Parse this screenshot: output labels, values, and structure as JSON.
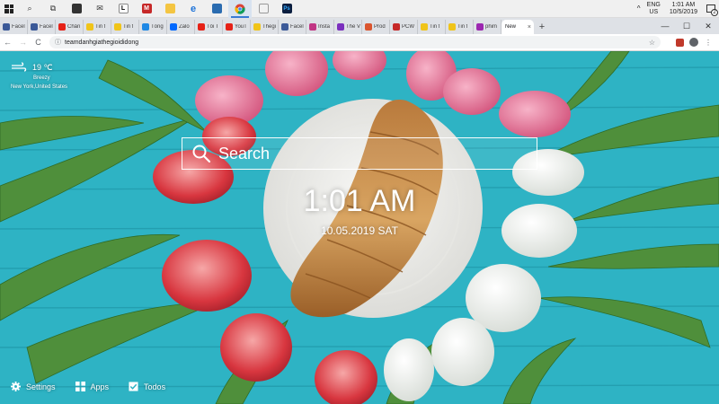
{
  "taskbar": {
    "icons": [
      {
        "name": "windows-start",
        "label": ""
      },
      {
        "name": "search-icon",
        "label": "⌕"
      },
      {
        "name": "task-view-icon",
        "label": "⧉"
      },
      {
        "name": "store-icon",
        "label": "🛍"
      },
      {
        "name": "mail-icon",
        "label": "✉"
      },
      {
        "name": "l-app-icon",
        "label": "L"
      },
      {
        "name": "mcafee-icon",
        "label": "M"
      },
      {
        "name": "file-explorer-icon",
        "label": "📁"
      },
      {
        "name": "edge-icon",
        "label": "e"
      },
      {
        "name": "photos-icon",
        "label": "▣"
      },
      {
        "name": "chrome-icon",
        "label": "◉"
      },
      {
        "name": "folder-icon",
        "label": "▭"
      },
      {
        "name": "photoshop-icon",
        "label": "Ps"
      }
    ],
    "tray": {
      "chevron": "^",
      "lang_1": "ENG",
      "lang_2": "US",
      "time": "1:01 AM",
      "date": "10/5/2019",
      "notif_count": "2"
    }
  },
  "tabs": [
    {
      "label": "Facel",
      "color": "#3b5998"
    },
    {
      "label": "Facel",
      "color": "#3b5998"
    },
    {
      "label": "Chân",
      "color": "#e62117"
    },
    {
      "label": "Tin t",
      "color": "#f0c419"
    },
    {
      "label": "Tin t",
      "color": "#f0c419"
    },
    {
      "label": "Tống",
      "color": "#1e88e5"
    },
    {
      "label": "Zalo",
      "color": "#0068ff"
    },
    {
      "label": "Tôi T",
      "color": "#e62117"
    },
    {
      "label": "YouT",
      "color": "#e62117"
    },
    {
      "label": "Thegi",
      "color": "#f0c419"
    },
    {
      "label": "Facel",
      "color": "#3b5998"
    },
    {
      "label": "Insta",
      "color": "#c13584"
    },
    {
      "label": "The V",
      "color": "#7b2fbe"
    },
    {
      "label": "Prod",
      "color": "#da552f"
    },
    {
      "label": "PCW",
      "color": "#c62828"
    },
    {
      "label": "Tin t",
      "color": "#f0c419"
    },
    {
      "label": "Tin t",
      "color": "#f0c419"
    },
    {
      "label": "phim",
      "color": "#9c27b0"
    }
  ],
  "active_tab": {
    "label": "New",
    "close": "×"
  },
  "new_tab_symbol": "+",
  "window_controls": {
    "minimize": "—",
    "maximize": "☐",
    "close": "✕"
  },
  "toolbar": {
    "back": "←",
    "forward": "→",
    "reload": "C",
    "info_icon": "ⓘ",
    "url": "teamdanhgiathegioididong",
    "star": "☆",
    "menu": "⋮"
  },
  "weather": {
    "temp": "19 ℃",
    "condition": "Breezy",
    "location": "New York,United States"
  },
  "search": {
    "placeholder": "Search"
  },
  "clock": {
    "time": "1:01 AM",
    "date": "10.05.2019 SAT"
  },
  "bottom_links": [
    {
      "label": "Settings"
    },
    {
      "label": "Apps"
    },
    {
      "label": "Todos"
    }
  ],
  "colors": {
    "wood": "#2fb5c5",
    "tulip_pink": "#e2688f",
    "tulip_red": "#d8363f",
    "tulip_white": "#f4f4f1",
    "leaf": "#4f8f3b",
    "plate": "#efefec",
    "croissant": "#c28a4a"
  }
}
